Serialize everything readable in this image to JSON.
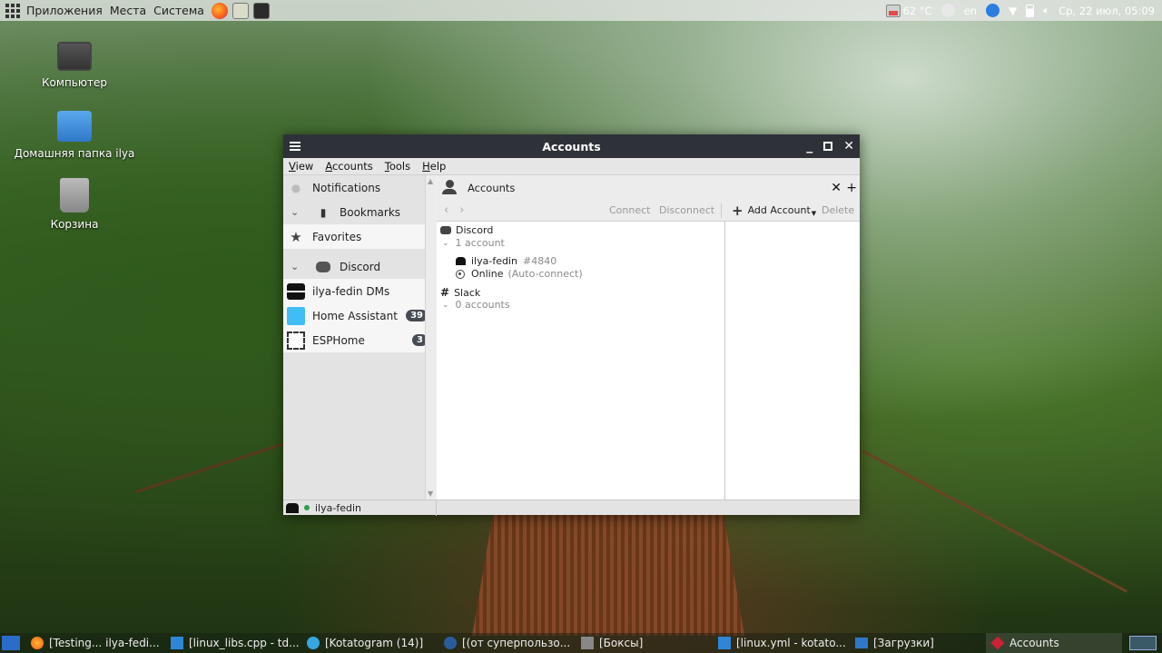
{
  "top_panel": {
    "menus": [
      "Приложения",
      "Места",
      "Система"
    ],
    "temperature": "62 °C",
    "keyboard_layout": "en",
    "clock": "Ср, 22 июл, 05:09"
  },
  "desktop_icons": [
    {
      "label": "Компьютер",
      "icon": "computer-icon"
    },
    {
      "label": "Домашняя папка ilya",
      "icon": "home-folder-icon"
    },
    {
      "label": "Корзина",
      "icon": "trash-icon"
    }
  ],
  "window": {
    "title": "Accounts",
    "menubar": [
      "View",
      "Accounts",
      "Tools",
      "Help"
    ],
    "sidebar": {
      "items": [
        {
          "label": "Notifications",
          "icon": "bell-icon"
        },
        {
          "label": "Bookmarks",
          "icon": "bookmark-icon"
        },
        {
          "label": "Favorites",
          "icon": "star-icon"
        },
        {
          "label": "Discord",
          "icon": "discord-icon"
        },
        {
          "label": "ilya-fedin DMs",
          "icon": "hat-icon"
        },
        {
          "label": "Home Assistant",
          "icon": "home-assistant-icon",
          "badge": "39"
        },
        {
          "label": "ESPHome",
          "icon": "esphome-icon",
          "badge": "3"
        }
      ]
    },
    "tab": {
      "title": "Accounts"
    },
    "toolbar": {
      "connect": "Connect",
      "disconnect": "Disconnect",
      "add_account": "Add Account",
      "delete": "Delete"
    },
    "tree": {
      "discord": {
        "name": "Discord",
        "count": "1 account"
      },
      "account": {
        "name": "ilya-fedin",
        "discriminator": "#4840",
        "status": "Online",
        "status_note": "(Auto-connect)"
      },
      "slack": {
        "name": "Slack",
        "count": "0 accounts"
      }
    },
    "status_bar": {
      "user": "ilya-fedin"
    }
  },
  "taskbar": {
    "items": [
      "[Testing... ilya-fedi...",
      "[linux_libs.cpp - td...",
      "[Kotatogram (14)]",
      "[(от суперпользо...",
      "[Боксы]",
      "[linux.yml - kotato...",
      "[Загрузки]",
      "Accounts"
    ]
  },
  "colors": {
    "titlebar": "#2e3238",
    "badge": "#474b52",
    "online": "#2e9c4e"
  }
}
